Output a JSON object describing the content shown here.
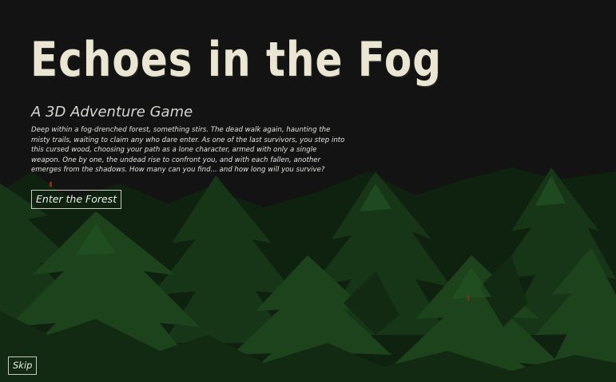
{
  "game": {
    "title": "Echoes in the Fog",
    "subtitle": "A 3D Adventure Game",
    "description": "Deep within a fog-drenched forest, something stirs. The dead walk again, haunting the misty trails, waiting to claim any who dare enter. As one of the last survivors, you step into this cursed wood, choosing your path as a lone character, armed with only a single weapon. One by one, the undead rise to confront you, and with each fallen, another emerges from the shadows. How many can you find... and how long will you survive?",
    "enter_button_label": "Enter the Forest",
    "skip_button_label": "Skip"
  },
  "colors": {
    "background": "#141414",
    "forest_dark": "#0d1f0d",
    "forest_mid": "#163616",
    "forest_light": "#1f4a1f",
    "text": "#ebe6d3"
  }
}
